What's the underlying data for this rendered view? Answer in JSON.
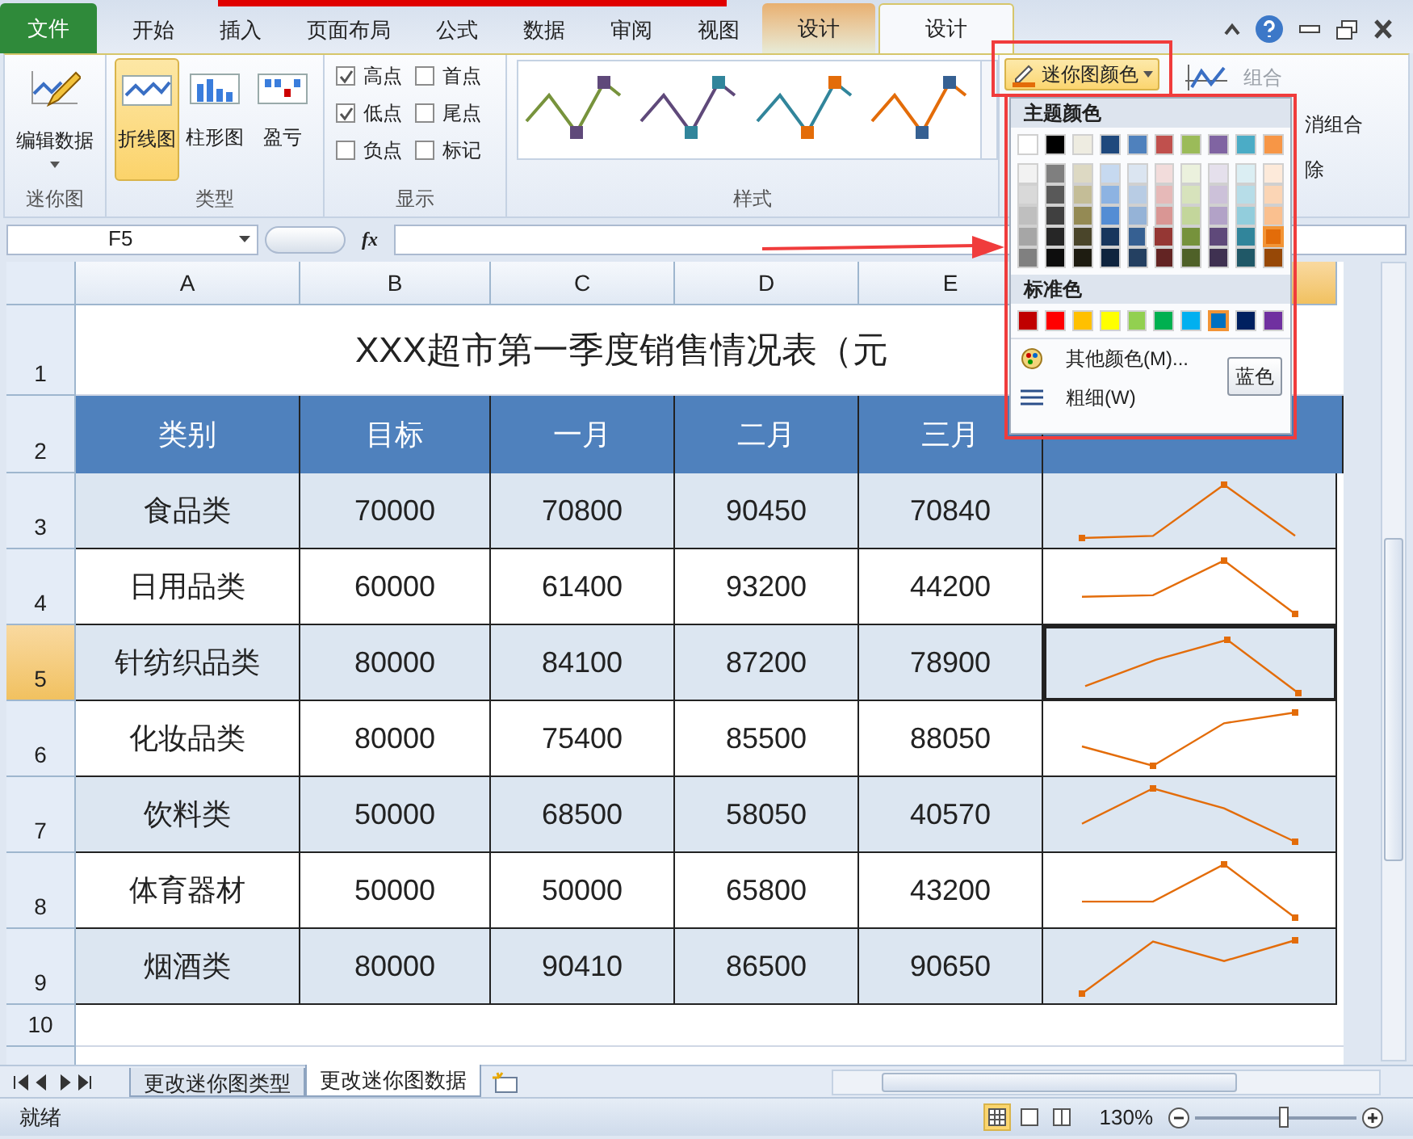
{
  "tabs": [
    {
      "label": "文件",
      "kind": "file",
      "selected": false
    },
    {
      "label": "开始",
      "kind": "plain",
      "selected": false
    },
    {
      "label": "插入",
      "kind": "plain",
      "selected": false
    },
    {
      "label": "页面布局",
      "kind": "plain",
      "selected": false
    },
    {
      "label": "公式",
      "kind": "plain",
      "selected": false
    },
    {
      "label": "数据",
      "kind": "plain",
      "selected": false
    },
    {
      "label": "审阅",
      "kind": "plain",
      "selected": false
    },
    {
      "label": "视图",
      "kind": "plain",
      "selected": false
    },
    {
      "label": "设计",
      "kind": "context",
      "selected": false
    },
    {
      "label": "设计",
      "kind": "context",
      "selected": true
    }
  ],
  "sparkline_group": {
    "label": "迷你图",
    "edit_button": "编辑数据"
  },
  "type_group": {
    "label": "类型",
    "types": [
      {
        "label": "折线图",
        "kind": "line",
        "selected": true
      },
      {
        "label": "柱形图",
        "kind": "column",
        "selected": false
      },
      {
        "label": "盈亏",
        "kind": "winloss",
        "selected": false
      }
    ]
  },
  "show_group": {
    "label": "显示",
    "options": [
      {
        "label": "高点",
        "kind": "high",
        "checked": true
      },
      {
        "label": "首点",
        "kind": "first",
        "checked": false
      },
      {
        "label": "低点",
        "kind": "low",
        "checked": true
      },
      {
        "label": "尾点",
        "kind": "last",
        "checked": false
      },
      {
        "label": "负点",
        "kind": "negative",
        "checked": false
      },
      {
        "label": "标记",
        "kind": "markers",
        "checked": false
      }
    ]
  },
  "style_group": {
    "label": "样式",
    "color_button": "迷你图颜色",
    "styles": [
      {
        "color": "#77933c",
        "marker": {
          "color": "#5f497a"
        }
      },
      {
        "color": "#5f497a",
        "marker": {
          "color": "#31859b"
        }
      },
      {
        "color": "#31859b",
        "marker": {
          "color": "#e36c09"
        }
      },
      {
        "color": "#e36c09",
        "marker": {
          "color": "#366092"
        }
      }
    ]
  },
  "group_group": {
    "items": [
      {
        "label": "组合",
        "disabled": true
      },
      {
        "label": "消组合",
        "disabled": false
      },
      {
        "label": "除",
        "disabled": false
      }
    ]
  },
  "formula_bar": {
    "name_box": "F5",
    "fx": "fx"
  },
  "sheet": {
    "columns": [
      {
        "label": "A",
        "selected": false
      },
      {
        "label": "B",
        "selected": false
      },
      {
        "label": "C",
        "selected": false
      },
      {
        "label": "D",
        "selected": false
      },
      {
        "label": "E",
        "selected": false
      },
      {
        "selected": true
      }
    ],
    "title_row": "1",
    "title": "XXX超市第一季度销售情况表（元",
    "header_row": "2",
    "header": [
      "类别",
      "目标",
      "一月",
      "二月",
      "三月"
    ],
    "rows": [
      {
        "number": "3",
        "selected": false,
        "category": "食品类",
        "values": [
          "70000",
          "70800",
          "90450",
          "70840"
        ]
      },
      {
        "number": "4",
        "selected": false,
        "category": "日用品类",
        "values": [
          "60000",
          "61400",
          "93200",
          "44200"
        ]
      },
      {
        "number": "5",
        "selected": true,
        "category": "针纺织品类",
        "values": [
          "80000",
          "84100",
          "87200",
          "78900"
        ]
      },
      {
        "number": "6",
        "selected": false,
        "category": "化妆品类",
        "values": [
          "80000",
          "75400",
          "85500",
          "88050"
        ]
      },
      {
        "number": "7",
        "selected": false,
        "category": "饮料类",
        "values": [
          "50000",
          "68500",
          "58050",
          "40570"
        ]
      },
      {
        "number": "8",
        "selected": false,
        "category": "体育器材",
        "values": [
          "50000",
          "50000",
          "65800",
          "43200"
        ]
      },
      {
        "number": "9",
        "selected": false,
        "category": "烟酒类",
        "values": [
          "80000",
          "90410",
          "86500",
          "90650"
        ]
      }
    ],
    "empty_rows": [
      "10"
    ]
  },
  "color_menu": {
    "theme_label": "主题颜色",
    "theme": [
      {
        "color": "#ffffff",
        "selected": false
      },
      {
        "color": "#000000",
        "selected": false
      },
      {
        "color": "#eeece1",
        "selected": false
      },
      {
        "color": "#1f497d",
        "selected": false
      },
      {
        "color": "#4f81bd",
        "selected": false
      },
      {
        "color": "#c0504d",
        "selected": false
      },
      {
        "color": "#9bbb59",
        "selected": false
      },
      {
        "color": "#8064a2",
        "selected": false
      },
      {
        "color": "#4bacc6",
        "selected": false
      },
      {
        "color": "#f79646",
        "selected": false
      }
    ],
    "shades": [
      [
        {
          "color": "#f2f2f2",
          "selected": false
        },
        {
          "color": "#7f7f7f",
          "selected": false
        },
        {
          "color": "#ddd9c3",
          "selected": false
        },
        {
          "color": "#c6d9f0",
          "selected": false
        },
        {
          "color": "#dbe5f1",
          "selected": false
        },
        {
          "color": "#f2dcdb",
          "selected": false
        },
        {
          "color": "#ebf1dd",
          "selected": false
        },
        {
          "color": "#e5e0ec",
          "selected": false
        },
        {
          "color": "#dbeef3",
          "selected": false
        },
        {
          "color": "#fdeada",
          "selected": false
        }
      ],
      [
        {
          "color": "#d9d9d9",
          "selected": false
        },
        {
          "color": "#595959",
          "selected": false
        },
        {
          "color": "#c4bd97",
          "selected": false
        },
        {
          "color": "#8db3e2",
          "selected": false
        },
        {
          "color": "#b8cce4",
          "selected": false
        },
        {
          "color": "#e6b9b8",
          "selected": false
        },
        {
          "color": "#d7e3bc",
          "selected": false
        },
        {
          "color": "#ccc1d9",
          "selected": false
        },
        {
          "color": "#b7dde8",
          "selected": false
        },
        {
          "color": "#fbd5b5",
          "selected": false
        }
      ],
      [
        {
          "color": "#bfbfbf",
          "selected": false
        },
        {
          "color": "#404040",
          "selected": false
        },
        {
          "color": "#948a54",
          "selected": false
        },
        {
          "color": "#548dd4",
          "selected": false
        },
        {
          "color": "#95b3d7",
          "selected": false
        },
        {
          "color": "#d99694",
          "selected": false
        },
        {
          "color": "#c3d69b",
          "selected": false
        },
        {
          "color": "#b2a2c7",
          "selected": false
        },
        {
          "color": "#92cddc",
          "selected": false
        },
        {
          "color": "#fac08f",
          "selected": false
        }
      ],
      [
        {
          "color": "#a6a6a6",
          "selected": false
        },
        {
          "color": "#262626",
          "selected": false
        },
        {
          "color": "#4a452a",
          "selected": false
        },
        {
          "color": "#17365d",
          "selected": false
        },
        {
          "color": "#366092",
          "selected": false
        },
        {
          "color": "#953734",
          "selected": false
        },
        {
          "color": "#76923c",
          "selected": false
        },
        {
          "color": "#5f497a",
          "selected": false
        },
        {
          "color": "#31859b",
          "selected": false
        },
        {
          "color": "#e36c09",
          "selected": true
        }
      ],
      [
        {
          "color": "#808080",
          "selected": false
        },
        {
          "color": "#0d0d0d",
          "selected": false
        },
        {
          "color": "#1e1c11",
          "selected": false
        },
        {
          "color": "#0f243e",
          "selected": false
        },
        {
          "color": "#244061",
          "selected": false
        },
        {
          "color": "#632423",
          "selected": false
        },
        {
          "color": "#4f6128",
          "selected": false
        },
        {
          "color": "#3f3151",
          "selected": false
        },
        {
          "color": "#205867",
          "selected": false
        },
        {
          "color": "#974806",
          "selected": false
        }
      ]
    ],
    "standard_label": "标准色",
    "standard": [
      {
        "color": "#c00000",
        "selected": false
      },
      {
        "color": "#ff0000",
        "selected": false
      },
      {
        "color": "#ffc000",
        "selected": false
      },
      {
        "color": "#ffff00",
        "selected": false
      },
      {
        "color": "#92d050",
        "selected": false
      },
      {
        "color": "#00b050",
        "selected": false
      },
      {
        "color": "#00b0f0",
        "selected": false
      },
      {
        "color": "#0070c0",
        "selected": true
      },
      {
        "color": "#002060",
        "selected": false
      },
      {
        "color": "#7030a0",
        "selected": false
      }
    ],
    "more": "其他颜色(M)...",
    "weight": "粗细(W)",
    "tooltip": "蓝色"
  },
  "sheet_tabs": [
    {
      "label": "更改迷你图类型",
      "selected": false
    },
    {
      "label": "更改迷你图数据",
      "selected": true
    }
  ],
  "status": {
    "text": "就绪",
    "views": [
      {
        "kind": "normal",
        "selected": true
      },
      {
        "kind": "layout",
        "selected": false
      },
      {
        "kind": "pagebreak",
        "selected": false
      }
    ],
    "zoom": "130%",
    "zoom_slider": {
      "level": 0.55
    }
  }
}
